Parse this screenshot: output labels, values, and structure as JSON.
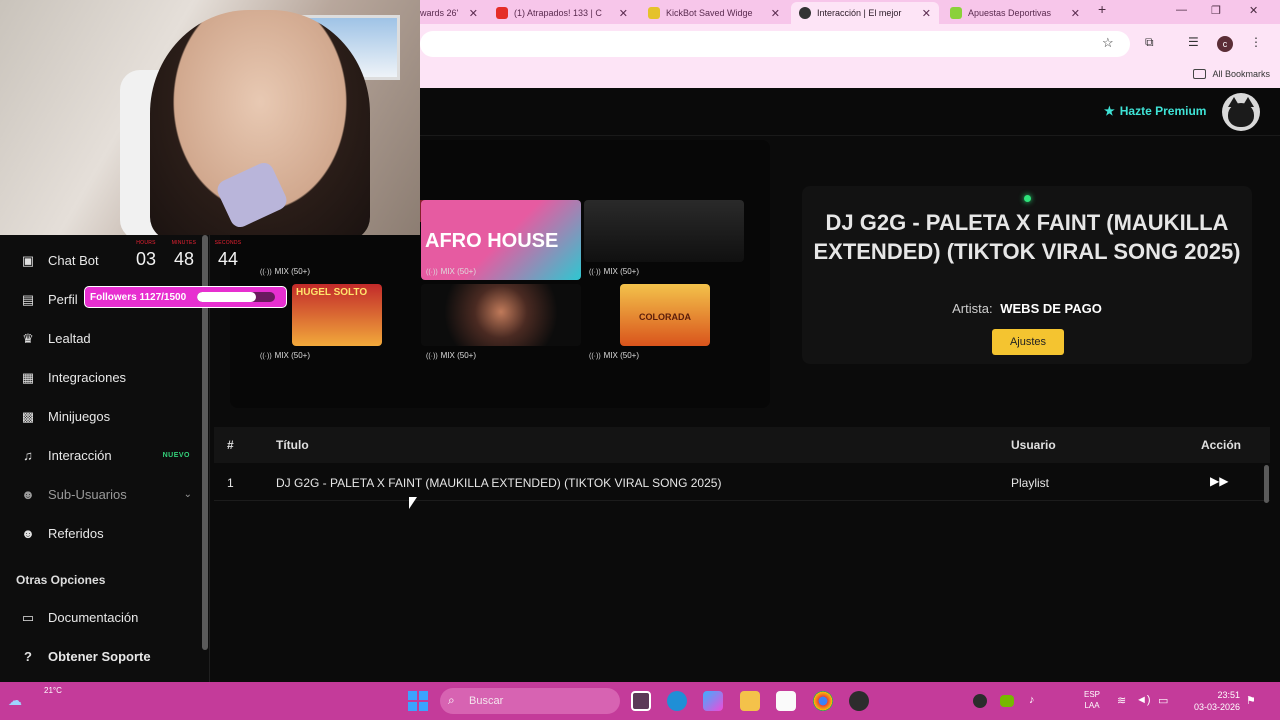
{
  "browser": {
    "tabs": [
      {
        "label": "wards 26'",
        "active": false
      },
      {
        "label": "(1) Atrapados! 133 | C",
        "active": false
      },
      {
        "label": "KickBot Saved Widge",
        "active": false
      },
      {
        "label": "Interacción | El mejor",
        "active": true
      },
      {
        "label": "Apuestas Deportivas",
        "active": false
      }
    ],
    "new_tab": "+",
    "avatar_letter": "c",
    "all_bookmarks": "All Bookmarks"
  },
  "header": {
    "premium_label": "Hazte Premium"
  },
  "timer": {
    "hours_label": "HOURS",
    "hours": "03",
    "minutes_label": "MINUTES",
    "minutes": "48",
    "seconds_label": "SECONDS",
    "seconds": "44"
  },
  "followers": {
    "text": "Followers 1127/1500",
    "progress": 0.75
  },
  "sidebar": {
    "items": [
      {
        "label": "Chat Bot",
        "icon": "robot-icon"
      },
      {
        "label": "Perfil",
        "icon": "id-card-icon"
      },
      {
        "label": "Lealtad",
        "icon": "trophy-icon"
      },
      {
        "label": "Integraciones",
        "icon": "chart-icon"
      },
      {
        "label": "Minijuegos",
        "icon": "gamepad-icon"
      },
      {
        "label": "Interacción",
        "icon": "music-icon",
        "badge": "NUEVO"
      },
      {
        "label": "Sub-Usuarios",
        "icon": "users-icon"
      },
      {
        "label": "Referidos",
        "icon": "users-icon"
      }
    ],
    "section": "Otras Opciones",
    "other": [
      {
        "label": "Documentación",
        "icon": "document-icon"
      },
      {
        "label": "Obtener Soporte",
        "icon": "help-icon"
      }
    ]
  },
  "playlists": {
    "mix_label": "MIX (50+)",
    "cards": [
      {
        "title": "",
        "colors": [
          "#1a5e3a",
          "#c21e2c"
        ]
      },
      {
        "title": "AFRO HOUSE",
        "colors": [
          "#e65ba1",
          "#2ec7d1"
        ]
      },
      {
        "title": "",
        "colors": [
          "#1c1c1c",
          "#3a3a3a"
        ]
      },
      {
        "title": "HUGEL SOLTO",
        "colors": [
          "#c22a2a",
          "#f2a93b"
        ]
      },
      {
        "title": "",
        "colors": [
          "#141414",
          "#7a4436"
        ]
      },
      {
        "title": "COLORADA",
        "colors": [
          "#f0b640",
          "#d95a1e"
        ]
      }
    ]
  },
  "now_playing": {
    "title": "DJ G2G - PALETA X FAINT (MAUKILLA EXTENDED) (TIKTOK VIRAL SONG 2025)",
    "artist_label": "Artista:",
    "artist": "WEBS DE PAGO",
    "settings_button": "Ajustes"
  },
  "table": {
    "headers": {
      "num": "#",
      "title": "Título",
      "user": "Usuario",
      "action": "Acción"
    },
    "rows": [
      {
        "num": "1",
        "title": "DJ G2G - PALETA X FAINT (MAUKILLA EXTENDED) (TIKTOK VIRAL SONG 2025)",
        "user": "Playlist"
      }
    ]
  },
  "taskbar": {
    "temperature": "21°C",
    "search": "Buscar",
    "lang": "ESP",
    "lang2": "LAA",
    "time": "23:51",
    "date": "03-03-2026"
  },
  "colors": {
    "accent_teal": "#3fe3d6",
    "button_yellow": "#f4c430",
    "taskbar_pink": "#c43b9a",
    "badge_green": "#33d17a"
  }
}
